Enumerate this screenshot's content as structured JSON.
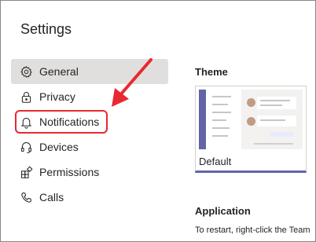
{
  "page": {
    "title": "Settings"
  },
  "sidebar": {
    "items": [
      {
        "label": "General",
        "icon": "gear-icon",
        "active": true
      },
      {
        "label": "Privacy",
        "icon": "lock-icon",
        "active": false
      },
      {
        "label": "Notifications",
        "icon": "bell-icon",
        "active": false
      },
      {
        "label": "Devices",
        "icon": "headset-icon",
        "active": false
      },
      {
        "label": "Permissions",
        "icon": "app-grid-icon",
        "active": false
      },
      {
        "label": "Calls",
        "icon": "phone-icon",
        "active": false
      }
    ]
  },
  "theme": {
    "heading": "Theme",
    "option_label": "Default"
  },
  "application": {
    "heading": "Application",
    "description": "To restart, right-click the Team"
  },
  "colors": {
    "accent": "#6264a7",
    "annotation_red": "#e8292f",
    "active_bg": "#e1dfdd"
  }
}
